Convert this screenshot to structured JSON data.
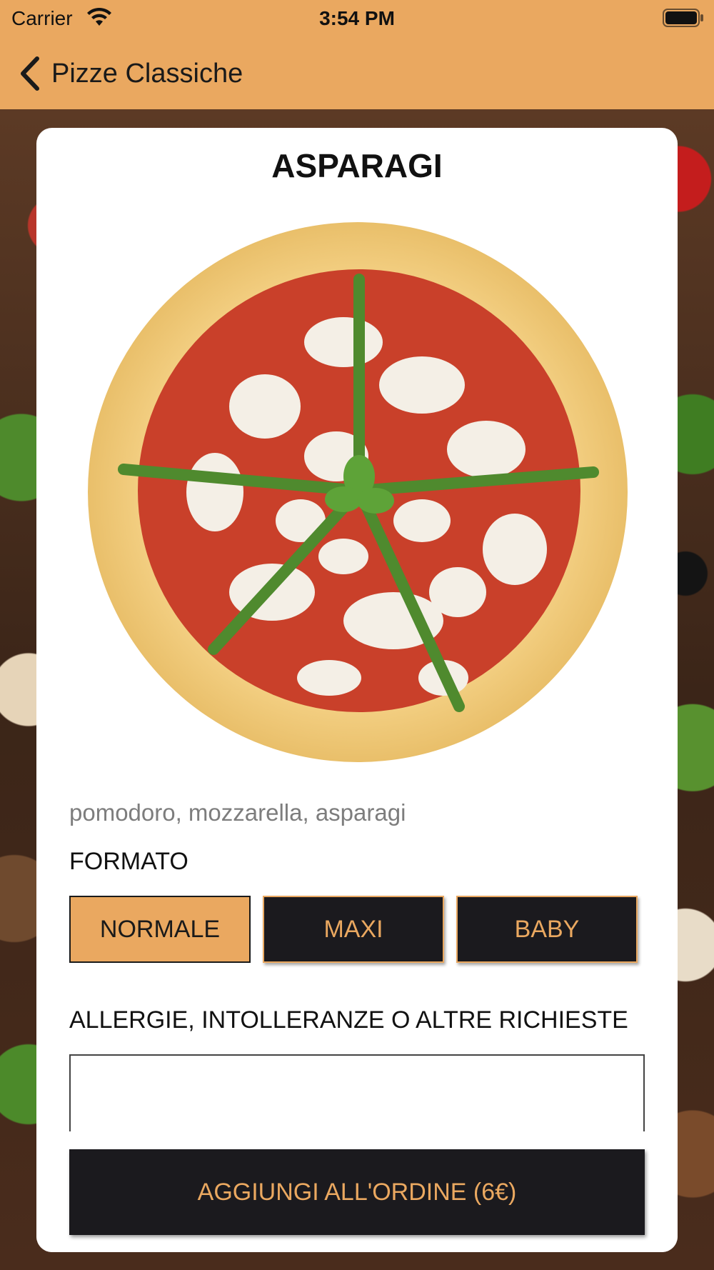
{
  "status_bar": {
    "carrier": "Carrier",
    "time": "3:54 PM"
  },
  "nav": {
    "back_icon": "chevron-left-icon",
    "title": "Pizze Classiche"
  },
  "product": {
    "name": "ASPARAGI",
    "ingredients": "pomodoro, mozzarella, asparagi"
  },
  "format": {
    "label": "FORMATO",
    "options": [
      "NORMALE",
      "MAXI",
      "BABY"
    ],
    "selected": "NORMALE"
  },
  "notes": {
    "label": "ALLERGIE, INTOLLERANZE O ALTRE RICHIESTE",
    "value": ""
  },
  "add_button": {
    "label": "AGGIUNGI ALL'ORDINE (6€)"
  },
  "colors": {
    "accent": "#eaa860",
    "dark": "#1b1a1e"
  }
}
